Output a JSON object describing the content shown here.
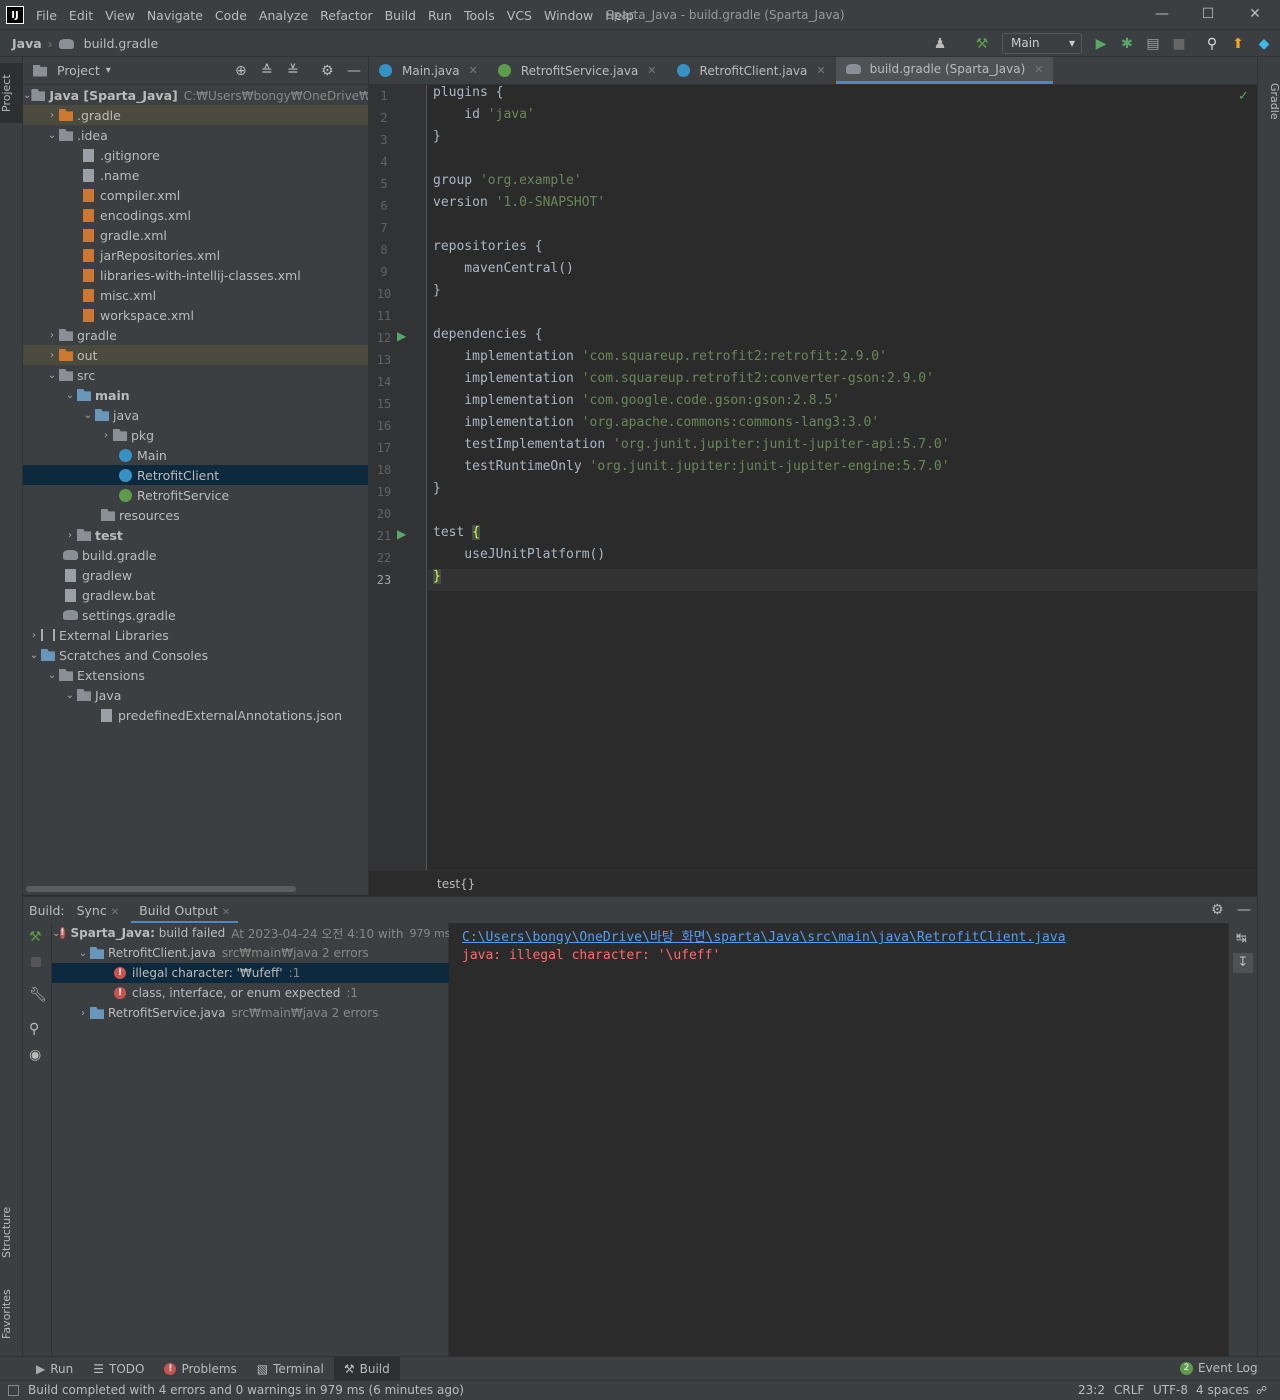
{
  "app": {
    "logo": "IJ",
    "window_title": "Sparta_Java - build.gradle (Sparta_Java)"
  },
  "menu": [
    "File",
    "Edit",
    "View",
    "Navigate",
    "Code",
    "Analyze",
    "Refactor",
    "Build",
    "Run",
    "Tools",
    "VCS",
    "Window",
    "Help"
  ],
  "breadcrumb": {
    "project": "Java",
    "file": "build.gradle"
  },
  "toolbar": {
    "run_config": "Main"
  },
  "left_stripe": {
    "project": "Project",
    "structure": "Structure",
    "favorites": "Favorites"
  },
  "right_stripe": {
    "gradle": "Gradle"
  },
  "project_panel": {
    "title": "Project",
    "rows": [
      {
        "label": "Java [Sparta_Java]",
        "hint": "C:₩Users₩bongy₩OneDrive₩바탕 화",
        "bold": true
      },
      {
        "label": ".gradle"
      },
      {
        "label": ".idea"
      },
      {
        "label": ".gitignore"
      },
      {
        "label": ".name"
      },
      {
        "label": "compiler.xml"
      },
      {
        "label": "encodings.xml"
      },
      {
        "label": "gradle.xml"
      },
      {
        "label": "jarRepositories.xml"
      },
      {
        "label": "libraries-with-intellij-classes.xml"
      },
      {
        "label": "misc.xml"
      },
      {
        "label": "workspace.xml"
      },
      {
        "label": "gradle"
      },
      {
        "label": "out"
      },
      {
        "label": "src"
      },
      {
        "label": "main"
      },
      {
        "label": "java"
      },
      {
        "label": "pkg"
      },
      {
        "label": "Main"
      },
      {
        "label": "RetrofitClient"
      },
      {
        "label": "RetrofitService"
      },
      {
        "label": "resources"
      },
      {
        "label": "test"
      },
      {
        "label": "build.gradle"
      },
      {
        "label": "gradlew"
      },
      {
        "label": "gradlew.bat"
      },
      {
        "label": "settings.gradle"
      },
      {
        "label": "External Libraries"
      },
      {
        "label": "Scratches and Consoles"
      },
      {
        "label": "Extensions"
      },
      {
        "label": "Java"
      },
      {
        "label": "predefinedExternalAnnotations.json"
      }
    ]
  },
  "editor": {
    "tabs": [
      "Main.java",
      "RetrofitService.java",
      "RetrofitClient.java",
      "build.gradle (Sparta_Java)"
    ],
    "line_numbers": [
      "1",
      "2",
      "3",
      "4",
      "5",
      "6",
      "7",
      "8",
      "9",
      "10",
      "11",
      "12",
      "13",
      "14",
      "15",
      "16",
      "17",
      "18",
      "19",
      "20",
      "21",
      "22",
      "23"
    ],
    "code": {
      "l1a": "plugins {",
      "l2a": "    id ",
      "l2b": "'java'",
      "l3a": "}",
      "l5a": "group ",
      "l5b": "'org.example'",
      "l6a": "version ",
      "l6b": "'1.0-SNAPSHOT'",
      "l8a": "repositories {",
      "l9a": "    mavenCentral()",
      "l10a": "}",
      "l12a": "dependencies {",
      "l13a": "    implementation ",
      "l13b": "'com.squareup.retrofit2:retrofit:2.9.0'",
      "l14a": "    implementation ",
      "l14b": "'com.squareup.retrofit2:converter-gson:2.9.0'",
      "l15a": "    implementation ",
      "l15b": "'com.google.code.gson:gson:2.8.5'",
      "l16a": "    implementation ",
      "l16b": "'org.apache.commons:commons-lang3:3.0'",
      "l17a": "    testImplementation ",
      "l17b": "'org.junit.jupiter:junit-jupiter-api:5.7.0'",
      "l18a": "    testRuntimeOnly ",
      "l18b": "'org.junit.jupiter:junit-jupiter-engine:5.7.0'",
      "l19a": "}",
      "l21a": "test ",
      "l21b": "{",
      "l22a": "    useJUnitPlatform()",
      "l23a": "}"
    },
    "breadcrumb": "test{}"
  },
  "build": {
    "label": "Build:",
    "tabs": [
      "Sync",
      "Build Output"
    ],
    "tree": {
      "root_name": "Sparta_Java:",
      "root_status": "build failed",
      "root_time": "At 2023-04-24 오전 4:10 with",
      "root_ms": "979 ms",
      "file1": "RetrofitClient.java",
      "file1_hint": "src₩main₩java 2 errors",
      "err1": "illegal character: '₩ufeff'",
      "err1_loc": ":1",
      "err2": "class, interface, or enum expected",
      "err2_loc": ":1",
      "file2": "RetrofitService.java",
      "file2_hint": "src₩main₩java 2 errors"
    },
    "output": {
      "path": "C:\\Users\\bongy\\OneDrive\\바탕 화면\\sparta\\Java\\src\\main\\java\\RetrofitClient.java",
      "error": "java: illegal character: '\\ufeff'"
    }
  },
  "tool_tabs": [
    "Run",
    "TODO",
    "Problems",
    "Terminal",
    "Build"
  ],
  "event_log": {
    "count": "2",
    "label": "Event Log"
  },
  "status": {
    "message": "Build completed with 4 errors and 0 warnings in 979 ms (6 minutes ago)",
    "position": "23:2",
    "line_sep": "CRLF",
    "encoding": "UTF-8",
    "indent": "4 spaces"
  },
  "colors": {
    "accent": "#4a88c7",
    "error": "#c75450",
    "string": "#6a8759",
    "keyword": "#cc7832"
  }
}
